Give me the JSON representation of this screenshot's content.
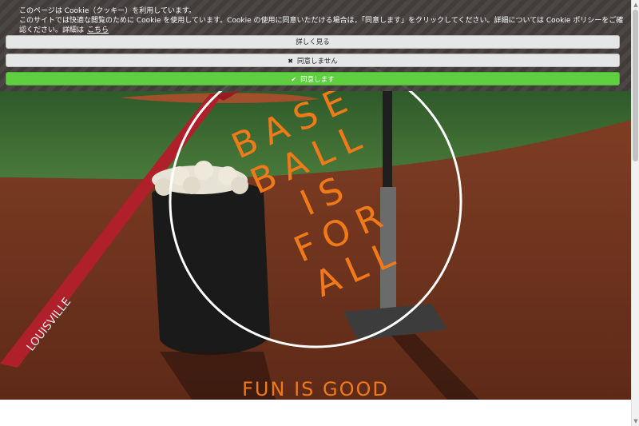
{
  "cookie": {
    "line1": "このページは Cookie（クッキー）を利用しています。",
    "line2": "このサイトでは快適な閲覧のために Cookie を使用しています。Cookie の使用に同意いただける場合は，「同意します」をクリックしてください。詳細については Cookie ポリシーをご確認ください。詳細は",
    "link": "こちら",
    "details_button": "詳しく見る",
    "decline_button": "同意しません",
    "decline_icon": "✖",
    "agree_button": "同意します",
    "agree_icon": "✔"
  },
  "hero": {
    "lines": [
      "BASE",
      "BALL",
      "IS",
      "FOR",
      "ALL"
    ],
    "tagline": "FUN IS GOOD",
    "bat_text": "LOUISVILLE"
  },
  "colors": {
    "accent": "#f07a1a",
    "agree": "#5fcf41",
    "banner": "#3c3c3c"
  }
}
